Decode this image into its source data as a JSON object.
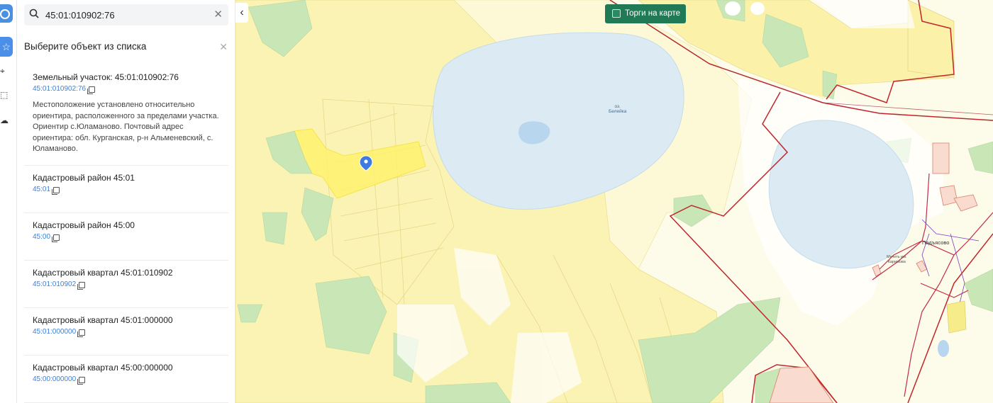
{
  "search": {
    "value": "45:01:010902:76"
  },
  "panel": {
    "title": "Выберите объект из списка",
    "items": [
      {
        "title": "Земельный участок: 45:01:010902:76",
        "code": "45:01:010902:76",
        "description": "Местоположение установлено относительно ориентира, расположенного за пределами участка. Ориентир с.Юламаново. Почтовый адрес ориентира: обл. Курганская, р-н Альменевский, с. Юламаново."
      },
      {
        "title": "Кадастровый район 45:01",
        "code": "45:01"
      },
      {
        "title": "Кадастровый район 45:00",
        "code": "45:00"
      },
      {
        "title": "Кадастровый квартал 45:01:010902",
        "code": "45:01:010902"
      },
      {
        "title": "Кадастровый квартал 45:01:000000",
        "code": "45:01:000000"
      },
      {
        "title": "Кадастровый квартал 45:00:000000",
        "code": "45:00:000000"
      }
    ]
  },
  "map": {
    "torgi_label": "Торги на карте",
    "lake_label_1": "оз.",
    "lake_label_2": "Белейка",
    "village_label": "Подъясово",
    "poi_label_1": "Мечеть им.",
    "poi_label_2": "Каримова"
  },
  "icons": [
    "search-icon",
    "clear-icon",
    "close-icon",
    "copy-icon",
    "chevron-left-icon",
    "star-icon",
    "map-pin-icon",
    "checkbox-icon"
  ],
  "colors": {
    "accent": "#4a8fe8",
    "torgi": "#1f7a55",
    "boundary": "#c0262b",
    "water": "#dbeaf3",
    "parcel": "#fbf3b3",
    "selected": "#fff36e",
    "forest": "#c9e6b6"
  }
}
